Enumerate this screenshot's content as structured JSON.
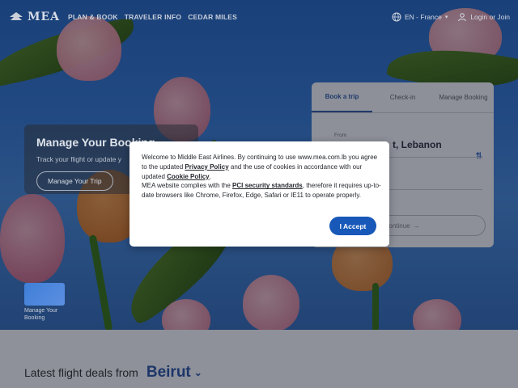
{
  "header": {
    "logo_text": "MEA",
    "nav": [
      "PLAN & BOOK",
      "TRAVELER INFO",
      "CEDAR MILES"
    ],
    "language": "EN - France",
    "login": "Login or Join"
  },
  "manage": {
    "title": "Manage Your Booking",
    "subtitle": "Track your flight or update y",
    "button": "Manage Your Trip"
  },
  "thumb": {
    "label": "Manage Your Booking"
  },
  "widget": {
    "tabs": [
      "Book a trip",
      "Check-in",
      "Manage Booking"
    ],
    "from_label": "From",
    "from_value": "t, Lebanon",
    "continue": "ontinue"
  },
  "deals": {
    "text": "Latest flight deals from",
    "city": "Beirut"
  },
  "cookie": {
    "p1_a": "Welcome to Middle East Airlines. By continuing to use www.mea.com.lb you agree to the updated ",
    "privacy": "Privacy Policy",
    "p1_b": " and the use of cookies in accordance with our updated ",
    "cookie_policy": "Cookie Policy",
    "p1_c": ".",
    "p2_a": "MEA website complies with the ",
    "pci": "PCI security standards",
    "p2_b": ", therefore it requires up-to-date browsers like Chrome, Firefox, Edge, Safari or IE11 to operate properly.",
    "accept": "I Accept"
  },
  "colors": {
    "accent": "#1758b8",
    "brand_dark": "#1c356a"
  }
}
